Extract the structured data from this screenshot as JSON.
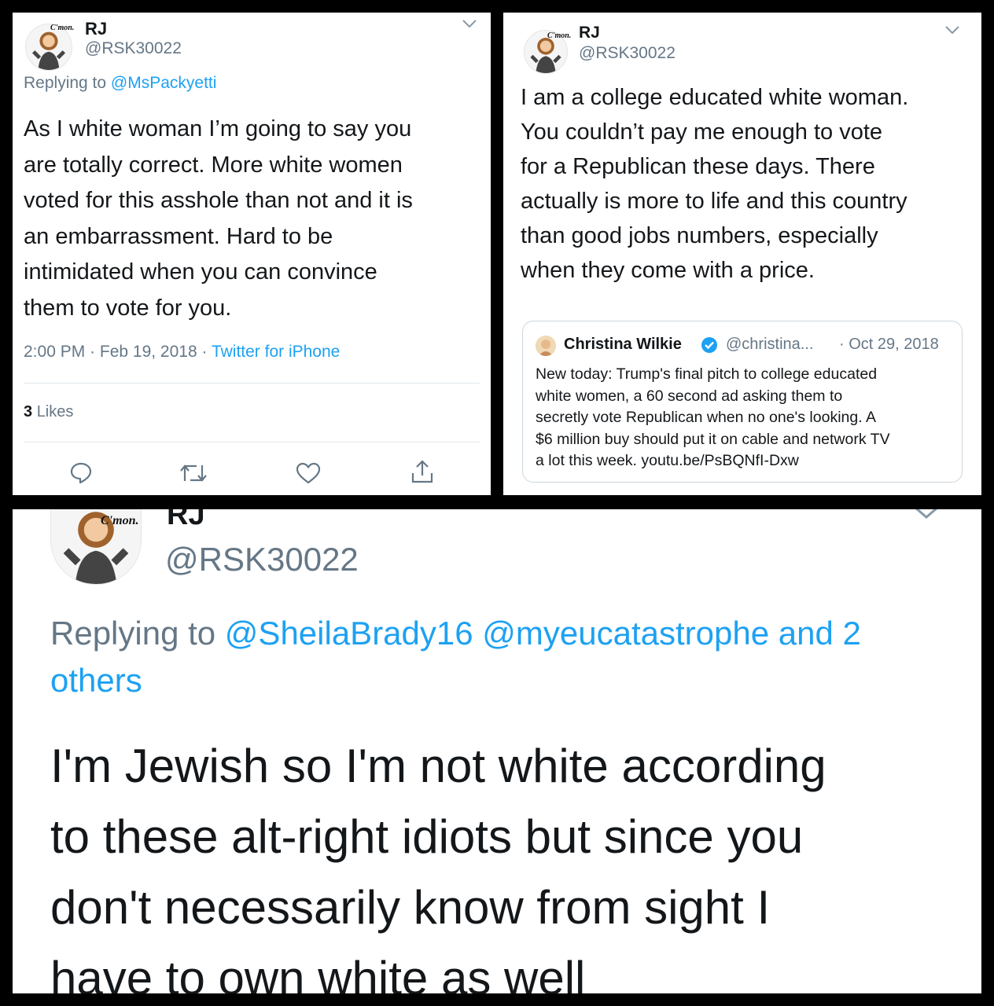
{
  "tweet1": {
    "name": "RJ",
    "handle": "@RSK30022",
    "avatar_caption": "C'mon.",
    "replying_prefix": "Replying to",
    "replying_to": "@MsPackyetti",
    "text_lines": [
      "As I white woman I’m going to say you",
      "are totally correct.  More white women",
      "voted for this asshole than not and it is",
      "an embarrassment.  Hard to be",
      "intimidated when you can convince",
      "them to vote for you."
    ],
    "time": "2:00 PM · Feb 19, 2018 ·",
    "source": "Twitter for iPhone",
    "likes_count": "3",
    "likes_label": "Likes",
    "icons": [
      "reply-icon",
      "retweet-icon",
      "like-icon",
      "share-icon"
    ]
  },
  "tweet2": {
    "name": "RJ",
    "handle": "@RSK30022",
    "avatar_caption": "C'mon.",
    "text_lines": [
      "I am a college educated white woman.",
      "You couldn’t pay me enough to vote",
      "for a Republican these days. There",
      "actually is more to life and this country",
      "than good jobs numbers, especially",
      "when they come with a price."
    ],
    "quote": {
      "name": "Christina Wilkie",
      "handle": "@christina...",
      "date": "· Oct 29, 2018",
      "text_lines": [
        "New today: Trump's final pitch to college educated",
        "white women, a 60 second ad asking them to",
        "secretly vote Republican when no one's looking. A",
        "$6 million buy should put it on cable and network TV",
        "a lot this week. youtu.be/PsBQNfI-Dxw"
      ]
    }
  },
  "tweet3": {
    "name": "RJ",
    "handle": "@RSK30022",
    "avatar_caption": "C'mon.",
    "replying_prefix": "Replying to",
    "replying_line1": "@SheilaBrady16 @myeucatastrophe and 2",
    "replying_line2": "others",
    "text_lines": [
      "I'm Jewish so I'm not white according",
      "to these alt-right idiots but since you",
      "don't necessarily know from sight I",
      "have to own white as well"
    ]
  },
  "colors": {
    "link": "#1da1f2",
    "secondary": "#657786",
    "text": "#14171a",
    "verified": "#1da1f2"
  }
}
